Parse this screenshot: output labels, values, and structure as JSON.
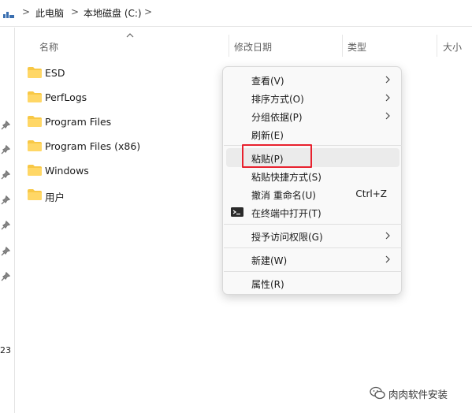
{
  "breadcrumb": {
    "items": [
      "此电脑",
      "本地磁盘 (C:)"
    ],
    "separator": ">"
  },
  "columns": {
    "name": "名称",
    "modified": "修改日期",
    "type": "类型",
    "size": "大小"
  },
  "files": [
    {
      "label": "ESD",
      "icon": "folder-icon"
    },
    {
      "label": "PerfLogs",
      "icon": "folder-icon"
    },
    {
      "label": "Program Files",
      "icon": "folder-icon"
    },
    {
      "label": "Program Files (x86)",
      "icon": "folder-icon"
    },
    {
      "label": "Windows",
      "icon": "folder-icon"
    },
    {
      "label": "用户",
      "icon": "folder-icon"
    }
  ],
  "nav": {
    "truncated_text": "23"
  },
  "context_menu": {
    "items": [
      {
        "label": "查看(V)",
        "submenu": true
      },
      {
        "label": "排序方式(O)",
        "submenu": true
      },
      {
        "label": "分组依据(P)",
        "submenu": true
      },
      {
        "label": "刷新(E)",
        "submenu": false
      },
      {
        "label": "粘贴(P)",
        "submenu": false,
        "hovered": true
      },
      {
        "label": "粘贴快捷方式(S)",
        "submenu": false
      },
      {
        "label": "撤消 重命名(U)",
        "shortcut": "Ctrl+Z"
      },
      {
        "label": "在终端中打开(T)",
        "icon": "terminal-icon"
      },
      {
        "label": "授予访问权限(G)",
        "submenu": true
      },
      {
        "label": "新建(W)",
        "submenu": true
      },
      {
        "label": "属性(R)",
        "submenu": false
      }
    ]
  },
  "watermark": {
    "text": "肉肉软件安装"
  },
  "colors": {
    "highlight_box": "#e8212e",
    "folder": "#f8c846",
    "menu_bg": "#f9f9f9"
  }
}
